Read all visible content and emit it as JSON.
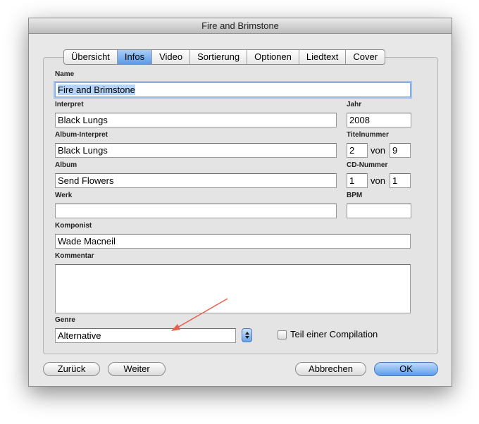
{
  "window": {
    "title": "Fire and Brimstone"
  },
  "tabs": [
    {
      "label": "Übersicht"
    },
    {
      "label": "Infos"
    },
    {
      "label": "Video"
    },
    {
      "label": "Sortierung"
    },
    {
      "label": "Optionen"
    },
    {
      "label": "Liedtext"
    },
    {
      "label": "Cover"
    }
  ],
  "fields": {
    "name": {
      "label": "Name",
      "value": "Fire and Brimstone"
    },
    "interpret": {
      "label": "Interpret",
      "value": "Black Lungs"
    },
    "jahr": {
      "label": "Jahr",
      "value": "2008"
    },
    "album_interpret": {
      "label": "Album-Interpret",
      "value": "Black Lungs"
    },
    "titelnummer": {
      "label": "Titelnummer",
      "value": "2",
      "of_label": "von",
      "total": "9"
    },
    "album": {
      "label": "Album",
      "value": "Send Flowers"
    },
    "cd_nummer": {
      "label": "CD-Nummer",
      "value": "1",
      "of_label": "von",
      "total": "1"
    },
    "werk": {
      "label": "Werk",
      "value": ""
    },
    "bpm": {
      "label": "BPM",
      "value": ""
    },
    "komponist": {
      "label": "Komponist",
      "value": "Wade Macneil"
    },
    "kommentar": {
      "label": "Kommentar",
      "value": ""
    },
    "genre": {
      "label": "Genre",
      "value": "Alternative"
    }
  },
  "compilation": {
    "label": "Teil einer Compilation",
    "checked": false
  },
  "buttons": {
    "back": "Zurück",
    "next": "Weiter",
    "cancel": "Abbrechen",
    "ok": "OK"
  },
  "colors": {
    "accent": "#5d9ae6",
    "annotation_arrow": "#e8604c"
  },
  "icons": {
    "stepper": "up-down-stepper-icon",
    "arrow": "annotation-arrow-icon"
  }
}
